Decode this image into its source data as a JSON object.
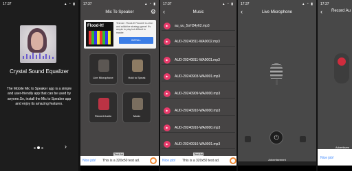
{
  "status_time": "17:37",
  "status_icons": "▴ ◔ ▮",
  "intro": {
    "title": "Crystal Sound Equalizer",
    "description": "The Mobile Mic to Speaker app is a simple and user-friendly app that can be used by anyone.So, install the Mic to Speaker app and enjoy its amazing features.",
    "next_icon": "›"
  },
  "home": {
    "title": "Mic To Speaker",
    "ad": {
      "app_name": "Flood-It!",
      "text": "Test Ad : Flood-It! Flood-It! is a fun and addictive strategy game! It's simple to play but difficult to master.",
      "install_label": "INSTALL"
    },
    "tiles": [
      {
        "label": "Live Microphone"
      },
      {
        "label": "Hold to Speak"
      },
      {
        "label": "Record Audio"
      },
      {
        "label": "Music"
      }
    ]
  },
  "banner": {
    "nice": "Nice job!",
    "test_text": "This is a 320x50 test ad.",
    "test_tag": "Test Ad"
  },
  "music": {
    "title": "Music",
    "tracks": [
      "au_uu_5oH34y62.mp3",
      "AUD-20240811-WA0002.mp3",
      "AUD-20240811-WA0001.mp3",
      "AUD-20240903-WA0001.mp3",
      "AUD-20240909-WA0000.mp3",
      "AUD-20240910-WA0000.mp3",
      "AUD-20240916-WA0000.mp3",
      "AUD-20240916-WA0001.mp3"
    ]
  },
  "live": {
    "title": "Live Microphone",
    "advertisement": "Advertisement"
  },
  "record": {
    "title": "Record Au",
    "advertisement": "Advertisem",
    "nice": "Nice job!"
  }
}
